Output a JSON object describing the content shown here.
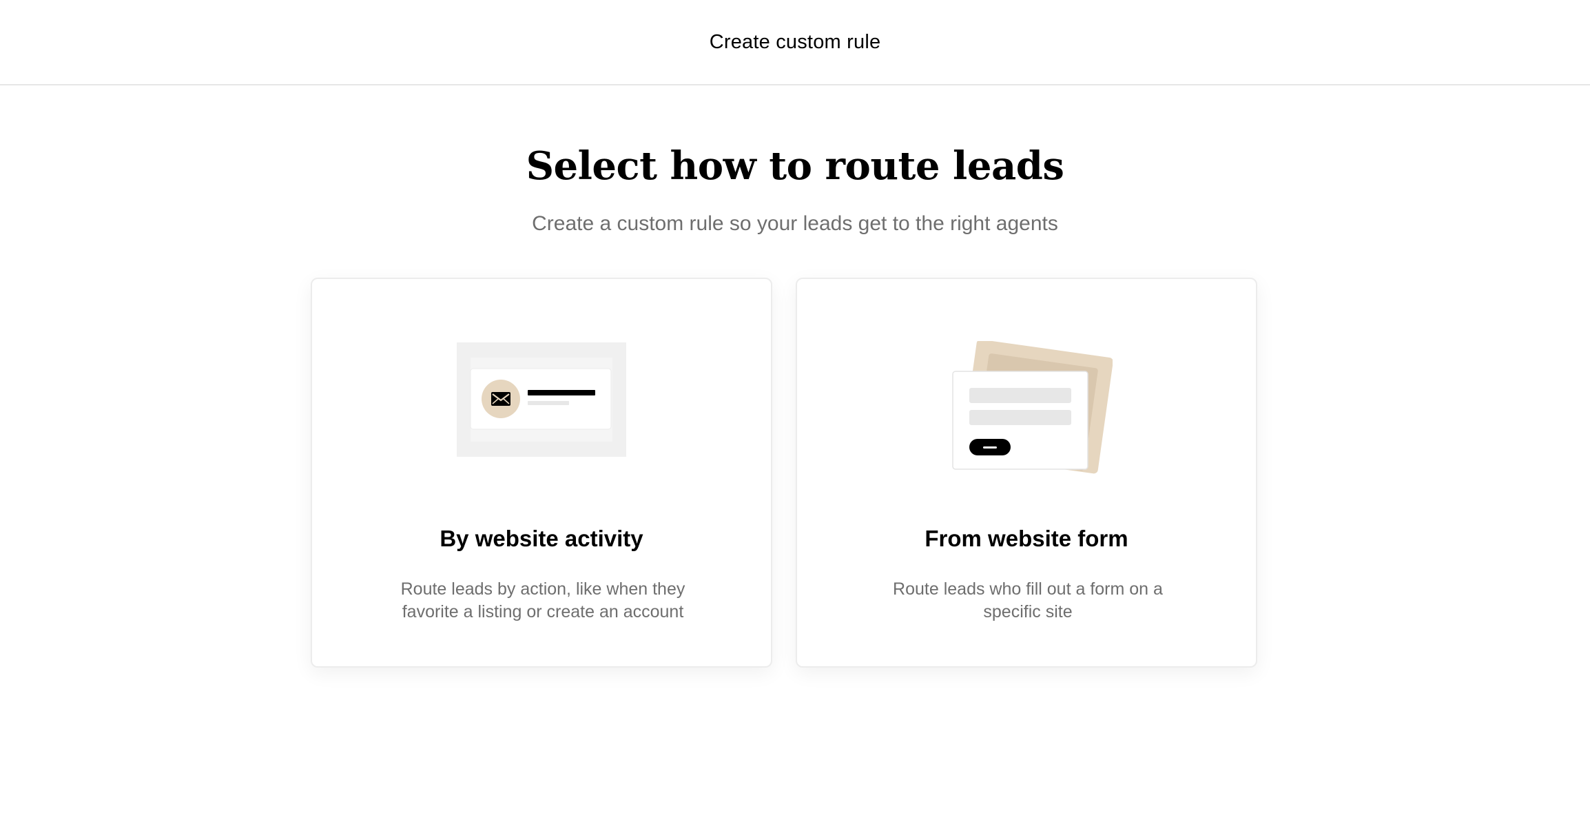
{
  "header": {
    "title": "Create custom rule"
  },
  "main": {
    "heading": "Select how to route leads",
    "subheading": "Create a custom rule so your leads get to the right agents",
    "options": [
      {
        "title": "By website activity",
        "description": "Route leads by action, like when they favorite a listing or create an account",
        "illustration_icon": "mail-icon"
      },
      {
        "title": "From website form",
        "description": "Route leads who fill out a form on a specific site",
        "illustration_icon": "form-illustration"
      }
    ]
  },
  "colors": {
    "accent_beige": "#e6d6bf",
    "muted_text": "#6e6e6e",
    "border": "#ececec"
  }
}
